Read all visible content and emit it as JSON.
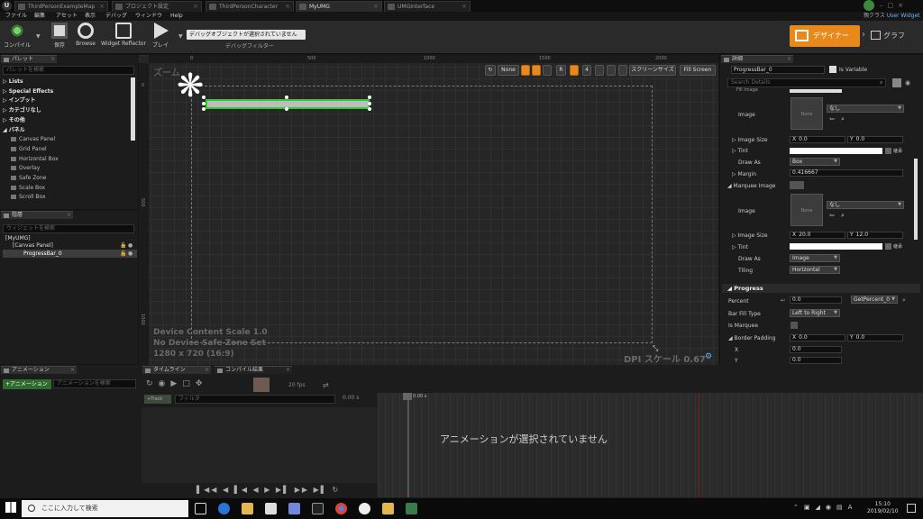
{
  "window_tabs": [
    {
      "label": "ThirdPersonExampleMap",
      "active": false
    },
    {
      "label": "プロジェクト設定",
      "active": false
    },
    {
      "label": "ThirdPersonCharacter",
      "active": false
    },
    {
      "label": "MyUMG",
      "active": true
    },
    {
      "label": "UMGInterface",
      "active": false
    }
  ],
  "menu": [
    "ファイル",
    "編集",
    "アセット",
    "表示",
    "デバッグ",
    "ウィンドウ",
    "Help"
  ],
  "parent_class": {
    "prefix": "親クラス",
    "value": "User Widget"
  },
  "toolbar": {
    "compile": "コンパイル",
    "save": "保存",
    "browse": "Browse",
    "reflector": "Widget Reflector",
    "play": "プレイ",
    "debug_select": "デバッグオブジェクトが選択されていません",
    "debug_filter": "デバッグフィルター",
    "designer": "デザイナー",
    "graph": "グラフ"
  },
  "palette": {
    "tab": "パレット",
    "search": "パレットを検索",
    "items": [
      {
        "label": "Lists",
        "kind": "cat"
      },
      {
        "label": "Special Effects",
        "kind": "cat"
      },
      {
        "label": "インプット",
        "kind": "cat"
      },
      {
        "label": "カテゴリなし",
        "kind": "cat"
      },
      {
        "label": "その他",
        "kind": "cat"
      },
      {
        "label": "パネル",
        "kind": "cat"
      },
      {
        "label": "Canvas Panel",
        "kind": "sub"
      },
      {
        "label": "Grid Panel",
        "kind": "sub"
      },
      {
        "label": "Horizontal Box",
        "kind": "sub"
      },
      {
        "label": "Overlay",
        "kind": "sub"
      },
      {
        "label": "Safe Zone",
        "kind": "sub"
      },
      {
        "label": "Scale Box",
        "kind": "sub"
      },
      {
        "label": "Scroll Box",
        "kind": "sub"
      }
    ]
  },
  "hierarchy": {
    "tab": "階層",
    "search": "ウィジェットを検索",
    "items": [
      "[MyUMG]",
      "[Canvas Panel]",
      "ProgressBar_0"
    ]
  },
  "viewport": {
    "zoom": "ズーム",
    "ruler_top": [
      "0",
      "500",
      "1000",
      "1500",
      "2000"
    ],
    "ruler_left": [
      "0",
      "500",
      "1000"
    ],
    "info_lines": [
      "Device Content Scale 1.0",
      "No Device Safe Zone Set",
      "1280 x 720 (16:9)"
    ],
    "dpi": "DPI スケール 0.67",
    "tools": {
      "none": "None",
      "r": "R",
      "four": "4",
      "screen_size": "スクリーンサイズ",
      "fill_screen": "Fill Screen"
    }
  },
  "details": {
    "tab": "詳細",
    "name": "ProgressBar_0",
    "is_variable": "Is Variable",
    "search": "Search Details",
    "fill_image_header": "Fill Image",
    "image_label": "Image",
    "image_value": "なし",
    "thumb_text": "None",
    "image_size_label": "Image Size",
    "tint_label": "Tint",
    "tint_extra": "継承",
    "draw_as_label": "Draw As",
    "margin_label": "Margin",
    "marquee_label": "Marquee Image",
    "tiling_label": "Tiling",
    "fill": {
      "size_x": "0.0",
      "size_y": "0.0",
      "draw_as": "Box",
      "margin": "0.416667"
    },
    "marquee": {
      "size_x": "20.0",
      "size_y": "12.0",
      "draw_as": "Image",
      "tiling": "Horizontal"
    },
    "progress_section": "Progress",
    "percent_label": "Percent",
    "percent": "0.0",
    "binding": "GetPercent_0",
    "fill_type_label": "Bar Fill Type",
    "fill_type": "Left to Right",
    "is_marquee_label": "Is Marquee",
    "border_label": "Border Padding",
    "border_x": "0.0",
    "border_y": "0.0",
    "x_label": "X",
    "y_label": "Y",
    "x_val": "0.0",
    "y_val": "0.0"
  },
  "bottom": {
    "anim_tab": "アニメーション",
    "timeline_tab": "タイムライン",
    "compile_tab": "コンパイル結果",
    "add_anim": "+アニメーション",
    "anim_search": "アニメーションを検索",
    "track": "+Track",
    "filter": "フィルタ",
    "fps": "20 fps",
    "time0": "0.00 s",
    "cursor": "0.00 s",
    "no_anim": "アニメーションが選択されていません"
  },
  "taskbar": {
    "search": "ここに入力して検索",
    "time": "15:10",
    "date": "2019/02/10"
  },
  "colors": {
    "accent": "#e8891b",
    "selection": "#2ecc2e"
  }
}
